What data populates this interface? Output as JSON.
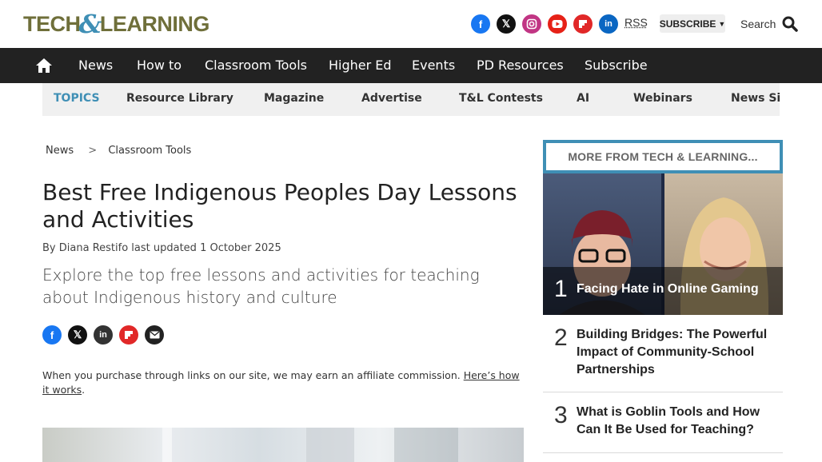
{
  "header": {
    "logo_part1": "TECH",
    "logo_amp": "&",
    "logo_part2": "LEARNING",
    "rss_label": "RSS",
    "subscribe_label": "SUBSCRIBE",
    "search_label": "Search",
    "social_icons": [
      "facebook-icon",
      "x-icon",
      "instagram-icon",
      "youtube-icon",
      "flipboard-icon",
      "linkedin-icon"
    ]
  },
  "nav": {
    "home_icon": "home-icon",
    "items": [
      "News",
      "How to",
      "Classroom Tools",
      "Higher Ed",
      "Events",
      "PD Resources",
      "Subscribe"
    ]
  },
  "topics": {
    "items": [
      "TOPICS",
      "Resource Library",
      "Magazine",
      "Advertise",
      "T&L Contests",
      "AI",
      "Webinars",
      "News Sign"
    ]
  },
  "article": {
    "breadcrumb": [
      "News",
      "Classroom Tools"
    ],
    "breadcrumb_sep": ">",
    "title": "Best Free Indigenous Peoples Day Lessons and Activities",
    "byline_by": "By",
    "author": "Diana Restifo",
    "updated_label": "last updated",
    "date": "1 October 2025",
    "dek": "Explore the top free lessons and activities for teaching about Indigenous history and culture",
    "share_icons": [
      "facebook-icon",
      "x-icon",
      "linkedin-icon",
      "flipboard-icon",
      "email-icon"
    ],
    "affiliate_text": "When you purchase through links on our site, we may earn an affiliate commission.",
    "affiliate_link": "Here’s how it works",
    "affiliate_end": "."
  },
  "sidebar": {
    "heading": "MORE FROM TECH & LEARNING...",
    "items": [
      {
        "rank": "1",
        "title": "Facing Hate in Online Gaming"
      },
      {
        "rank": "2",
        "title": "Building Bridges: The Powerful Impact of Community-School Partnerships"
      },
      {
        "rank": "3",
        "title": "What is Goblin Tools and How Can It Be Used for Teaching?"
      }
    ]
  },
  "colors": {
    "brand_olive": "#6f6f3a",
    "brand_blue": "#3f8fb5",
    "nav_bg": "#222222",
    "topics_bg": "#f0f0f0"
  }
}
